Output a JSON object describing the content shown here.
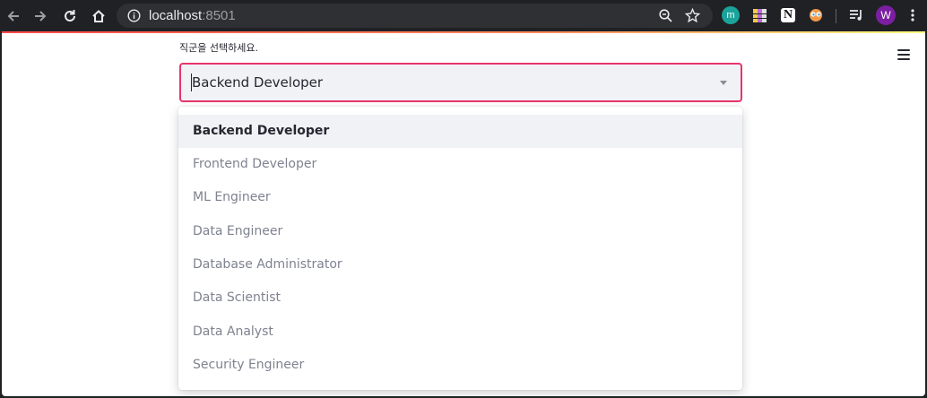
{
  "browser": {
    "url_host": "localhost",
    "url_port": ":8501",
    "extension_m_label": "m",
    "extension_notion_label": "N",
    "profile_initial": "W"
  },
  "colors": {
    "accent_border": "#e8356a",
    "selected_option_bg": "#f0f2f6",
    "option_text": "#7f8290",
    "selected_text": "#262730"
  },
  "select": {
    "label": "직군을 선택하세요.",
    "value": "Backend Developer",
    "options": [
      "Backend Developer",
      "Frontend Developer",
      "ML Engineer",
      "Data Engineer",
      "Database Administrator",
      "Data Scientist",
      "Data Analyst",
      "Security Engineer"
    ],
    "selected_index": 0
  }
}
